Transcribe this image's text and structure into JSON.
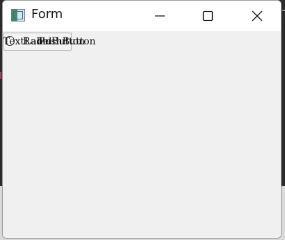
{
  "window": {
    "title": "Form",
    "icon": "app-window-icon"
  },
  "caption_buttons": {
    "minimize_icon": "minimize-icon",
    "maximize_icon": "maximize-icon",
    "close_icon": "close-icon"
  },
  "client": {
    "overlapping_widgets": {
      "text_label": "TextLabel",
      "radio_label": "RadioButton",
      "push_label": "PushButton"
    }
  }
}
